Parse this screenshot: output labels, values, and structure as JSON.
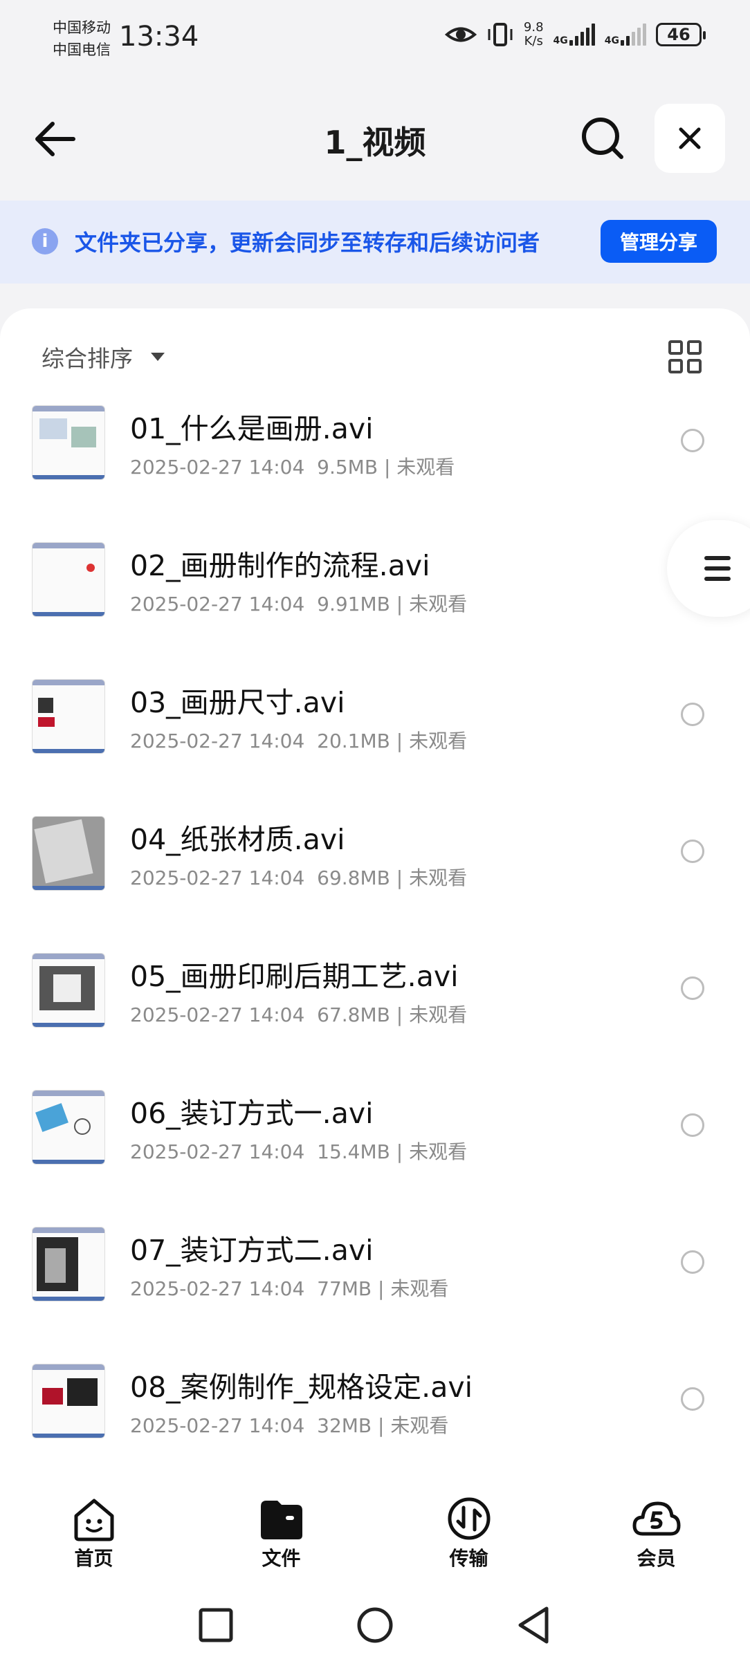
{
  "status_bar": {
    "carrier1": "中国移动",
    "carrier2": "中国电信",
    "time": "13:34",
    "net_speed_value": "9.8",
    "net_speed_unit": "K/s",
    "net1": "4G",
    "net2": "4G",
    "battery": "46"
  },
  "header": {
    "title": "1_视频"
  },
  "share_banner": {
    "text": "文件夹已分享，更新会同步至转存和后续访问者",
    "button": "管理分享"
  },
  "toolbar": {
    "sort_label": "综合排序"
  },
  "files": [
    {
      "name": "01_什么是画册.avi",
      "date": "2025-02-27 14:04",
      "size": "9.5MB",
      "status": "未观看"
    },
    {
      "name": "02_画册制作的流程.avi",
      "date": "2025-02-27 14:04",
      "size": "9.91MB",
      "status": "未观看"
    },
    {
      "name": "03_画册尺寸.avi",
      "date": "2025-02-27 14:04",
      "size": "20.1MB",
      "status": "未观看"
    },
    {
      "name": "04_纸张材质.avi",
      "date": "2025-02-27 14:04",
      "size": "69.8MB",
      "status": "未观看"
    },
    {
      "name": "05_画册印刷后期工艺.avi",
      "date": "2025-02-27 14:04",
      "size": "67.8MB",
      "status": "未观看"
    },
    {
      "name": "06_装订方式一.avi",
      "date": "2025-02-27 14:04",
      "size": "15.4MB",
      "status": "未观看"
    },
    {
      "name": "07_装订方式二.avi",
      "date": "2025-02-27 14:04",
      "size": "77MB",
      "status": "未观看"
    },
    {
      "name": "08_案例制作_规格设定.avi",
      "date": "2025-02-27 14:04",
      "size": "32MB",
      "status": "未观看"
    }
  ],
  "bottom_nav": [
    {
      "label": "首页",
      "icon": "home-smile-icon"
    },
    {
      "label": "文件",
      "icon": "folder-icon"
    },
    {
      "label": "传输",
      "icon": "transfer-icon"
    },
    {
      "label": "会员",
      "icon": "vip-cloud-icon"
    }
  ],
  "colors": {
    "accent": "#0a5cf5",
    "banner_bg": "#e7ecfb",
    "banner_text": "#1a56e8"
  }
}
